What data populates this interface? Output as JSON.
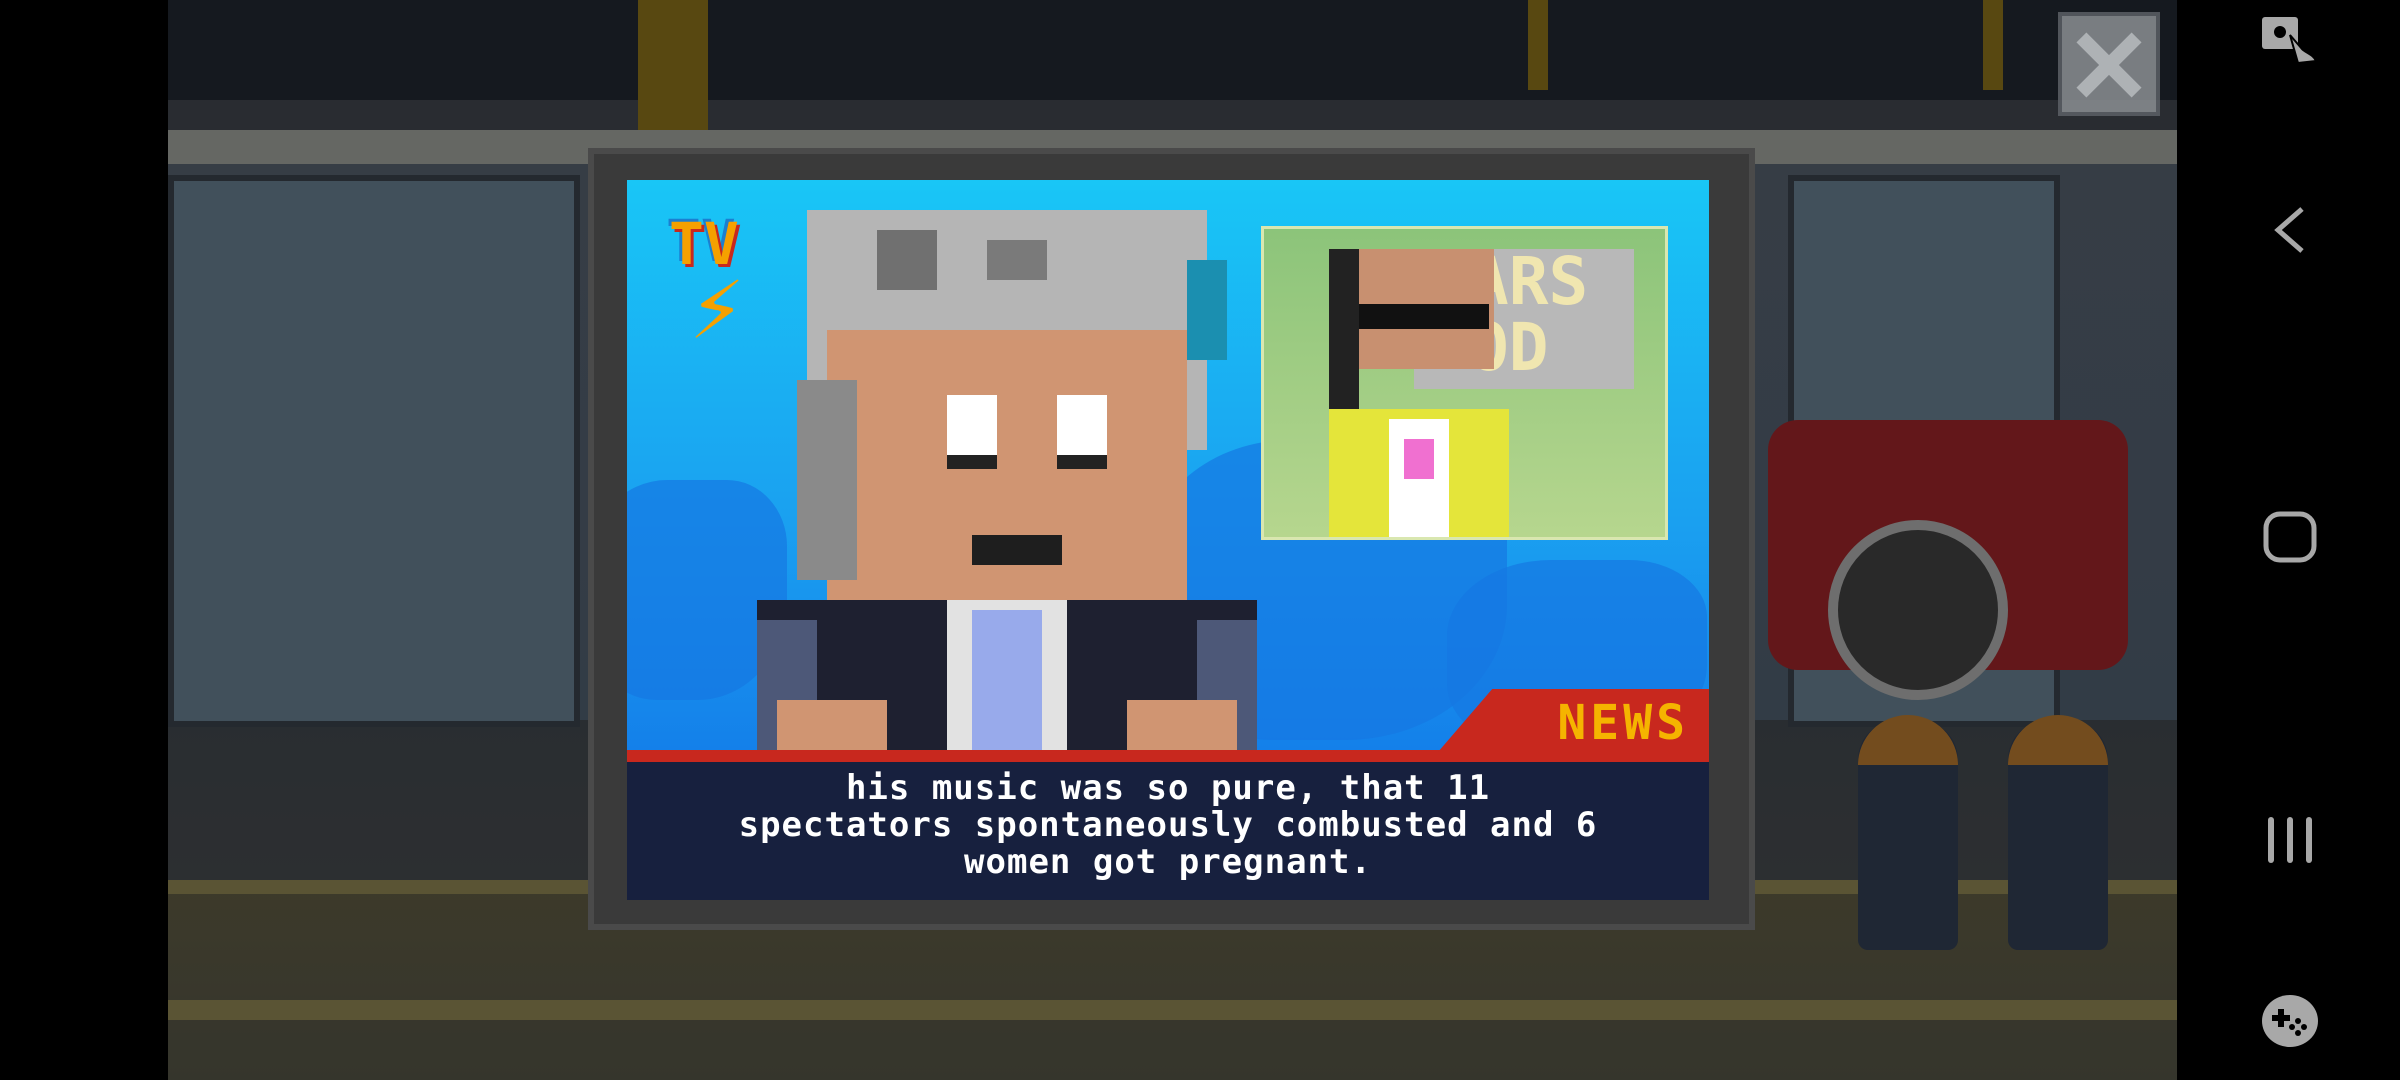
{
  "game": {
    "tv_logo": "TV",
    "news_tag": "NEWS",
    "inset_sign": "ARS OD",
    "caption_lines": [
      "his music was so pure, that 11",
      "spectators spontaneously combusted and 6",
      "women got pregnant."
    ],
    "close_icon": "close-x-icon"
  },
  "nav_bar": {
    "icons": [
      "touch-lock-icon",
      "back-icon",
      "home-icon",
      "recents-icon",
      "game-tools-icon"
    ]
  },
  "colors": {
    "news_red": "#c8281e",
    "news_text": "#f5b400",
    "caption_bg": "#17203e",
    "screen_blue": "#19c6f6"
  }
}
